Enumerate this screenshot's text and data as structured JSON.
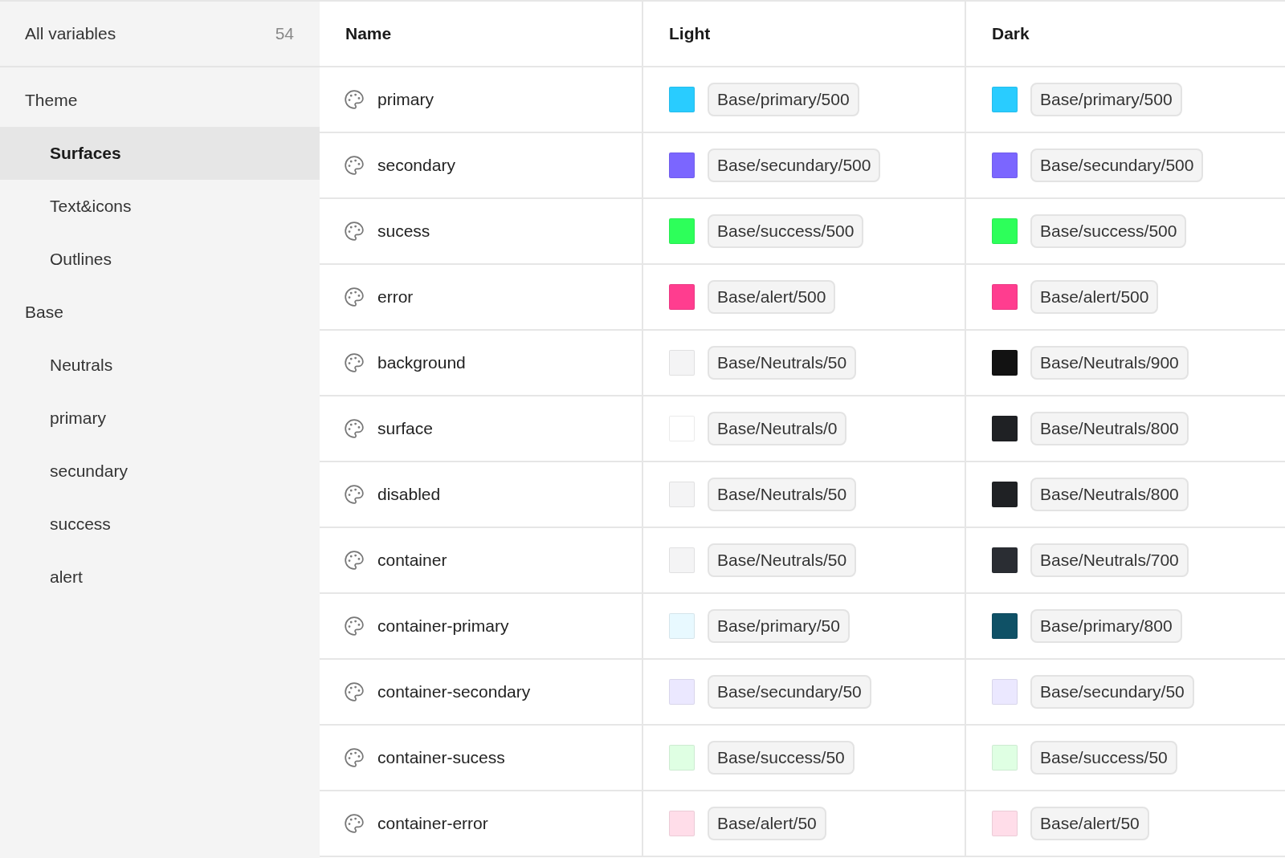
{
  "sidebar": {
    "all": {
      "label": "All variables",
      "count": "54",
      "selected": false
    },
    "groups": [
      {
        "label": "Theme",
        "selected": false,
        "children": [
          {
            "label": "Surfaces",
            "selected": true
          },
          {
            "label": "Text&icons",
            "selected": false
          },
          {
            "label": "Outlines",
            "selected": false
          }
        ]
      },
      {
        "label": "Base",
        "selected": false,
        "children": [
          {
            "label": "Neutrals",
            "selected": false
          },
          {
            "label": "primary",
            "selected": false
          },
          {
            "label": "secundary",
            "selected": false
          },
          {
            "label": "success",
            "selected": false
          },
          {
            "label": "alert",
            "selected": false
          }
        ]
      }
    ]
  },
  "table": {
    "columns": [
      "Name",
      "Light",
      "Dark"
    ],
    "rows": [
      {
        "name": "primary",
        "light": {
          "value": "Base/primary/500",
          "color": "#29ccff"
        },
        "dark": {
          "value": "Base/primary/500",
          "color": "#29ccff"
        }
      },
      {
        "name": "secondary",
        "light": {
          "value": "Base/secundary/500",
          "color": "#7b66ff"
        },
        "dark": {
          "value": "Base/secundary/500",
          "color": "#7b66ff"
        }
      },
      {
        "name": "sucess",
        "light": {
          "value": "Base/success/500",
          "color": "#2dff5a"
        },
        "dark": {
          "value": "Base/success/500",
          "color": "#2dff5a"
        }
      },
      {
        "name": "error",
        "light": {
          "value": "Base/alert/500",
          "color": "#ff3d8f"
        },
        "dark": {
          "value": "Base/alert/500",
          "color": "#ff3d8f"
        }
      },
      {
        "name": "background",
        "light": {
          "value": "Base/Neutrals/50",
          "color": "#f4f4f5"
        },
        "dark": {
          "value": "Base/Neutrals/900",
          "color": "#121212"
        }
      },
      {
        "name": "surface",
        "light": {
          "value": "Base/Neutrals/0",
          "color": "#ffffff"
        },
        "dark": {
          "value": "Base/Neutrals/800",
          "color": "#1f2124"
        }
      },
      {
        "name": "disabled",
        "light": {
          "value": "Base/Neutrals/50",
          "color": "#f4f4f5"
        },
        "dark": {
          "value": "Base/Neutrals/800",
          "color": "#1f2124"
        }
      },
      {
        "name": "container",
        "light": {
          "value": "Base/Neutrals/50",
          "color": "#f4f4f5"
        },
        "dark": {
          "value": "Base/Neutrals/700",
          "color": "#2a2d33"
        }
      },
      {
        "name": "container-primary",
        "light": {
          "value": "Base/primary/50",
          "color": "#e8f9ff"
        },
        "dark": {
          "value": "Base/primary/800",
          "color": "#0f5166"
        }
      },
      {
        "name": "container-secondary",
        "light": {
          "value": "Base/secundary/50",
          "color": "#ebe8ff"
        },
        "dark": {
          "value": "Base/secundary/50",
          "color": "#ebe8ff"
        }
      },
      {
        "name": "container-sucess",
        "light": {
          "value": "Base/success/50",
          "color": "#dfffe3"
        },
        "dark": {
          "value": "Base/success/50",
          "color": "#dfffe3"
        }
      },
      {
        "name": "container-error",
        "light": {
          "value": "Base/alert/50",
          "color": "#ffdde9"
        },
        "dark": {
          "value": "Base/alert/50",
          "color": "#ffdde9"
        }
      }
    ]
  }
}
